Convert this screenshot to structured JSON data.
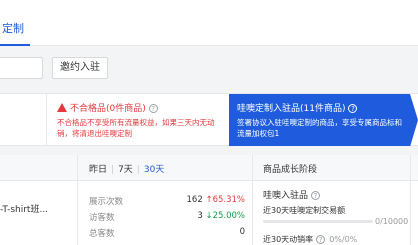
{
  "tabs": {
    "active_label": "定制"
  },
  "toolbar": {
    "button_a": "",
    "button_b": "邀约入驻"
  },
  "cards": {
    "warn": {
      "title": "不合格品(0件商品)",
      "desc": "不合格品不享受所有流量权益，如果三天内无动销，将清退出哇噢定制"
    },
    "featured": {
      "title": "哇噢定制入驻品(11件商品)",
      "desc": "签署协议入驻哇噢定制的商品，享受专属商品标和流量加权包1"
    }
  },
  "period": {
    "yesterday": "昨日",
    "days7": "7天",
    "days30": "30天",
    "active": "30天"
  },
  "stage": {
    "title": "商品成长阶段",
    "current": "哇噢入驻品",
    "gmv_label": "近30天哇噢定制交易额",
    "gmv_value": "0/10000",
    "gmv_progress": 0,
    "sell_rate_label": "近30天动销率",
    "sell_rate_value": "0%/0%"
  },
  "product": {
    "name": "-T-shirt班..."
  },
  "metrics": [
    {
      "label": "展示次数",
      "value": "162",
      "change": "↑65.31%",
      "trend": "up"
    },
    {
      "label": "访客数",
      "value": "3",
      "change": "↓25.00%",
      "trend": "down"
    },
    {
      "label": "总客数",
      "value": "0",
      "change": "",
      "trend": ""
    }
  ],
  "colors": {
    "brand": "#1f5cdd",
    "danger": "#e4393c",
    "success": "#1a9a4a"
  }
}
